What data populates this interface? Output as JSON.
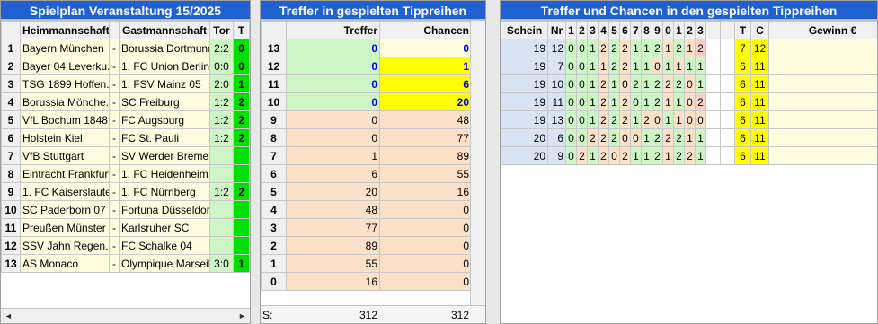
{
  "left": {
    "title": "Spielplan Veranstaltung 15/2025",
    "headers": {
      "home": "Heimmannschaft",
      "away": "Gastmannschaft",
      "tor": "Tor",
      "t": "T"
    },
    "rows": [
      {
        "n": "1",
        "home": "Bayern München",
        "away": "Borussia Dortmund",
        "tor": "2:2",
        "t": "0"
      },
      {
        "n": "2",
        "home": "Bayer 04 Leverku...",
        "away": "1. FC Union Berlin",
        "tor": "0:0",
        "t": "0"
      },
      {
        "n": "3",
        "home": "TSG 1899 Hoffen...",
        "away": "1. FSV Mainz 05",
        "tor": "2:0",
        "t": "1"
      },
      {
        "n": "4",
        "home": "Borussia Mönche...",
        "away": "SC Freiburg",
        "tor": "1:2",
        "t": "2"
      },
      {
        "n": "5",
        "home": "VfL Bochum 1848",
        "away": "FC Augsburg",
        "tor": "1:2",
        "t": "2"
      },
      {
        "n": "6",
        "home": "Holstein Kiel",
        "away": "FC St. Pauli",
        "tor": "1:2",
        "t": "2"
      },
      {
        "n": "7",
        "home": "VfB Stuttgart",
        "away": "SV Werder Bremen",
        "tor": "",
        "t": ""
      },
      {
        "n": "8",
        "home": "Eintracht Frankfurt",
        "away": "1. FC Heidenheim...",
        "tor": "",
        "t": ""
      },
      {
        "n": "9",
        "home": "1. FC Kaiserslautern",
        "away": "1. FC Nürnberg",
        "tor": "1:2",
        "t": "2"
      },
      {
        "n": "10",
        "home": "SC Paderborn 07",
        "away": "Fortuna Düsseldorf",
        "tor": "",
        "t": ""
      },
      {
        "n": "11",
        "home": "Preußen Münster",
        "away": "Karlsruher SC",
        "tor": "",
        "t": ""
      },
      {
        "n": "12",
        "home": "SSV Jahn Regen...",
        "away": "FC Schalke 04",
        "tor": "",
        "t": ""
      },
      {
        "n": "13",
        "home": "AS Monaco",
        "away": "Olympique Marseille",
        "tor": "3:0",
        "t": "1"
      }
    ],
    "sep": "-"
  },
  "middle": {
    "title": "Treffer in gespielten Tippreihen",
    "headers": {
      "treffer": "Treffer",
      "chancen": "Chancen"
    },
    "rows": [
      {
        "n": "13",
        "treffer": "0",
        "chancen": "0",
        "style": "top"
      },
      {
        "n": "12",
        "treffer": "0",
        "chancen": "1",
        "style": "top"
      },
      {
        "n": "11",
        "treffer": "0",
        "chancen": "6",
        "style": "top"
      },
      {
        "n": "10",
        "treffer": "0",
        "chancen": "20",
        "style": "top"
      },
      {
        "n": "9",
        "treffer": "0",
        "chancen": "48",
        "style": "low"
      },
      {
        "n": "8",
        "treffer": "0",
        "chancen": "77",
        "style": "low"
      },
      {
        "n": "7",
        "treffer": "1",
        "chancen": "89",
        "style": "low"
      },
      {
        "n": "6",
        "treffer": "6",
        "chancen": "55",
        "style": "low"
      },
      {
        "n": "5",
        "treffer": "20",
        "chancen": "16",
        "style": "low"
      },
      {
        "n": "4",
        "treffer": "48",
        "chancen": "0",
        "style": "low"
      },
      {
        "n": "3",
        "treffer": "77",
        "chancen": "0",
        "style": "low"
      },
      {
        "n": "2",
        "treffer": "89",
        "chancen": "0",
        "style": "low"
      },
      {
        "n": "1",
        "treffer": "55",
        "chancen": "0",
        "style": "low"
      },
      {
        "n": "0",
        "treffer": "16",
        "chancen": "0",
        "style": "low"
      }
    ],
    "sum_label": "S:",
    "sum_treffer": "312",
    "sum_chancen": "312"
  },
  "right": {
    "title": "Treffer und Chancen in den gespielten Tippreihen",
    "headers": [
      "Schein",
      "Nr",
      "1",
      "2",
      "3",
      "4",
      "5",
      "6",
      "7",
      "8",
      "9",
      "0",
      "1",
      "2",
      "3",
      "",
      "",
      "T",
      "C",
      "Gewinn €"
    ],
    "rows": [
      {
        "schein": "19",
        "nr": "12",
        "cells": [
          "0",
          "0",
          "1",
          "2",
          "2",
          "2",
          "1",
          "1",
          "2",
          "1",
          "2",
          "1",
          "2"
        ],
        "t": "7",
        "c": "12"
      },
      {
        "schein": "19",
        "nr": "7",
        "cells": [
          "0",
          "0",
          "1",
          "1",
          "2",
          "2",
          "1",
          "1",
          "0",
          "1",
          "1",
          "1",
          "1"
        ],
        "t": "6",
        "c": "11"
      },
      {
        "schein": "19",
        "nr": "10",
        "cells": [
          "0",
          "0",
          "1",
          "2",
          "1",
          "0",
          "2",
          "1",
          "2",
          "2",
          "2",
          "0",
          "1"
        ],
        "t": "6",
        "c": "11"
      },
      {
        "schein": "19",
        "nr": "11",
        "cells": [
          "0",
          "0",
          "1",
          "2",
          "1",
          "2",
          "0",
          "1",
          "2",
          "1",
          "1",
          "0",
          "2"
        ],
        "t": "6",
        "c": "11"
      },
      {
        "schein": "19",
        "nr": "13",
        "cells": [
          "0",
          "0",
          "1",
          "2",
          "2",
          "2",
          "1",
          "2",
          "0",
          "1",
          "1",
          "0",
          "0"
        ],
        "t": "6",
        "c": "11"
      },
      {
        "schein": "20",
        "nr": "6",
        "cells": [
          "0",
          "0",
          "2",
          "2",
          "2",
          "0",
          "0",
          "1",
          "2",
          "2",
          "2",
          "1",
          "1"
        ],
        "t": "6",
        "c": "11"
      },
      {
        "schein": "20",
        "nr": "9",
        "cells": [
          "0",
          "2",
          "1",
          "2",
          "0",
          "2",
          "1",
          "1",
          "2",
          "1",
          "2",
          "2",
          "1"
        ],
        "t": "6",
        "c": "11"
      }
    ],
    "cell_colors": [
      [
        "g",
        "g",
        "g",
        "s",
        "g",
        "s",
        "g",
        "g",
        "g",
        "s",
        "g",
        "s",
        "p"
      ],
      [
        "g",
        "g",
        "g",
        "s",
        "g",
        "s",
        "g",
        "g",
        "s",
        "g",
        "s",
        "g",
        "g"
      ],
      [
        "g",
        "g",
        "g",
        "s",
        "g",
        "s",
        "g",
        "g",
        "g",
        "s",
        "g",
        "s",
        "g"
      ],
      [
        "g",
        "g",
        "g",
        "s",
        "g",
        "s",
        "g",
        "g",
        "g",
        "s",
        "g",
        "s",
        "p"
      ],
      [
        "g",
        "g",
        "g",
        "s",
        "g",
        "s",
        "g",
        "s",
        "s",
        "g",
        "s",
        "s",
        "s"
      ],
      [
        "g",
        "g",
        "s",
        "s",
        "g",
        "s",
        "s",
        "g",
        "g",
        "s",
        "g",
        "s",
        "g"
      ],
      [
        "g",
        "s",
        "g",
        "s",
        "s",
        "s",
        "g",
        "g",
        "g",
        "s",
        "g",
        "s",
        "g"
      ]
    ]
  },
  "colors": {
    "title_bg": "#2060d0",
    "title_fg": "#ffffff",
    "green": "#cdf5c5",
    "salmon": "#fde0c8",
    "yellow": "#ffff00",
    "bright_green": "#00e000"
  }
}
